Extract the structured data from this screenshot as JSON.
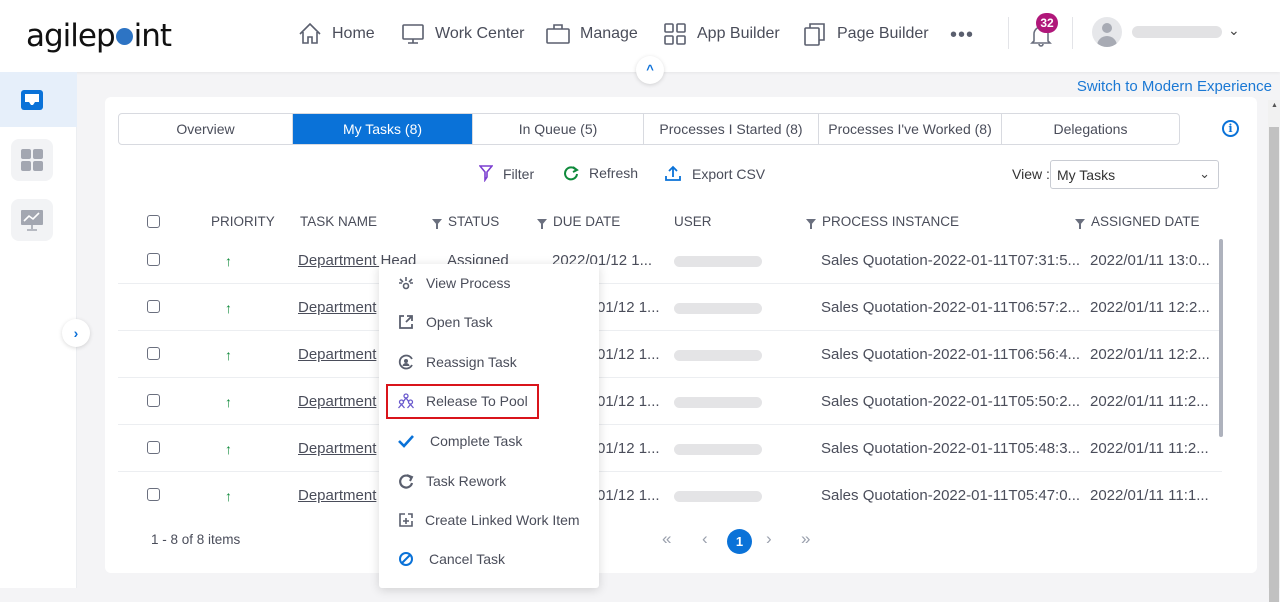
{
  "brand": {
    "logo_text_a": "agilep",
    "logo_text_b": "int",
    "accent": "#0a72d8",
    "badge_color": "#b0177a",
    "highlight_color": "#d9141b"
  },
  "topnav": {
    "items": [
      {
        "label": "Home",
        "icon": "home-icon"
      },
      {
        "label": "Work Center",
        "icon": "monitor-icon"
      },
      {
        "label": "Manage",
        "icon": "briefcase-icon"
      },
      {
        "label": "App Builder",
        "icon": "grid-icon"
      },
      {
        "label": "Page Builder",
        "icon": "pages-icon"
      }
    ],
    "more_label": "•••",
    "notifications_count": "32",
    "user_chevron": "⌄",
    "collapse_glyph": "^"
  },
  "switch_link": "Switch to Modern Experience",
  "sidebar": {
    "items": [
      {
        "name": "inbox",
        "active": true
      },
      {
        "name": "dashboard",
        "active": false
      },
      {
        "name": "reports",
        "active": false
      }
    ],
    "expand_glyph": "›"
  },
  "tabs": [
    {
      "label": "Overview",
      "active": false
    },
    {
      "label": "My Tasks (8)",
      "active": true
    },
    {
      "label": "In Queue (5)",
      "active": false
    },
    {
      "label": "Processes I Started (8)",
      "active": false
    },
    {
      "label": "Processes I've Worked (8)",
      "active": false
    },
    {
      "label": "Delegations",
      "active": false
    }
  ],
  "info_glyph": "i",
  "toolbar": {
    "filter_label": "Filter",
    "refresh_label": "Refresh",
    "export_label": "Export CSV",
    "view_label": "View :",
    "view_value": "My Tasks",
    "view_chevron": "⌄"
  },
  "table": {
    "columns": [
      "PRIORITY",
      "TASK NAME",
      "STATUS",
      "DUE DATE",
      "USER",
      "PROCESS INSTANCE",
      "ASSIGNED DATE"
    ],
    "priority_glyph": "↑",
    "rows": [
      {
        "task": "Department Head",
        "status": "Assigned",
        "due": "2022/01/12 1...",
        "process": "Sales Quotation-2022-01-11T07:31:5...",
        "assigned": "2022/01/11 13:0..."
      },
      {
        "task": "Department",
        "status": "",
        "due": "01/12 1...",
        "process": "Sales Quotation-2022-01-11T06:57:2...",
        "assigned": "2022/01/11 12:2..."
      },
      {
        "task": "Department",
        "status": "",
        "due": "01/12 1...",
        "process": "Sales Quotation-2022-01-11T06:56:4...",
        "assigned": "2022/01/11 12:2..."
      },
      {
        "task": "Department",
        "status": "",
        "due": "01/12 1...",
        "process": "Sales Quotation-2022-01-11T05:50:2...",
        "assigned": "2022/01/11 11:2..."
      },
      {
        "task": "Department",
        "status": "",
        "due": "01/12 1...",
        "process": "Sales Quotation-2022-01-11T05:48:3...",
        "assigned": "2022/01/11 11:2..."
      },
      {
        "task": "Department",
        "status": "",
        "due": "01/12 1...",
        "process": "Sales Quotation-2022-01-11T05:47:0...",
        "assigned": "2022/01/11 11:1..."
      }
    ]
  },
  "footer": {
    "items_info": "1 - 8 of 8 items",
    "first": "«",
    "prev": "‹",
    "current_page": "1",
    "next": "›",
    "last": "»"
  },
  "context_menu": {
    "items": [
      {
        "label": "View Process",
        "icon": "view-process-icon"
      },
      {
        "label": "Open Task",
        "icon": "open-task-icon"
      },
      {
        "label": "Reassign Task",
        "icon": "reassign-icon"
      },
      {
        "label": "Release To Pool",
        "icon": "release-pool-icon",
        "highlighted": true
      },
      {
        "label": "Complete Task",
        "icon": "checkmark-icon"
      },
      {
        "label": "Task Rework",
        "icon": "rework-icon"
      },
      {
        "label": "Create Linked Work Item",
        "icon": "linked-item-icon"
      },
      {
        "label": "Cancel Task",
        "icon": "cancel-icon"
      }
    ]
  }
}
